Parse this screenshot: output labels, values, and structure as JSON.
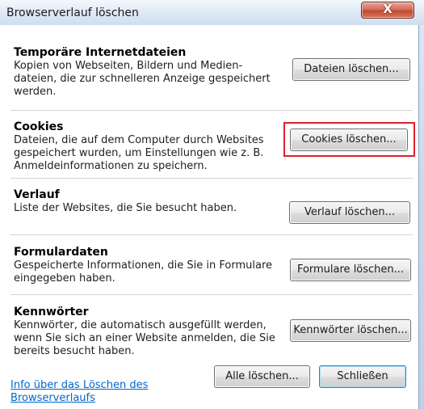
{
  "window": {
    "title": "Browserverlauf löschen",
    "close_glyph": "X"
  },
  "sections": [
    {
      "heading": "Temporäre Internetdateien",
      "description": "Kopien von Webseiten, Bildern und Medien-dateien, die zur schnelleren Anzeige gespeichert werden.",
      "button_label": "Dateien löschen..."
    },
    {
      "heading": "Cookies",
      "description": "Dateien, die auf dem Computer durch Websites gespeichert wurden, um Einstellungen wie z. B. Anmeldeinformationen zu speichern.",
      "button_label": "Cookies löschen..."
    },
    {
      "heading": "Verlauf",
      "description": "Liste der Websites, die Sie besucht haben.",
      "button_label": "Verlauf löschen..."
    },
    {
      "heading": "Formulardaten",
      "description": "Gespeicherte Informationen, die Sie in Formulare eingegeben haben.",
      "button_label": "Formulare löschen..."
    },
    {
      "heading": "Kennwörter",
      "description": "Kennwörter, die automatisch ausgefüllt werden, wenn Sie sich an einer Website anmelden, die Sie bereits besucht haben.",
      "button_label": "Kennwörter löschen..."
    }
  ],
  "footer": {
    "info_link": "Info über das Löschen des Browserverlaufs",
    "delete_all_label": "Alle löschen...",
    "close_label": "Schließen"
  },
  "colors": {
    "highlight_border": "#e0202a",
    "link": "#0066cc",
    "close_button": "#c24a32"
  }
}
